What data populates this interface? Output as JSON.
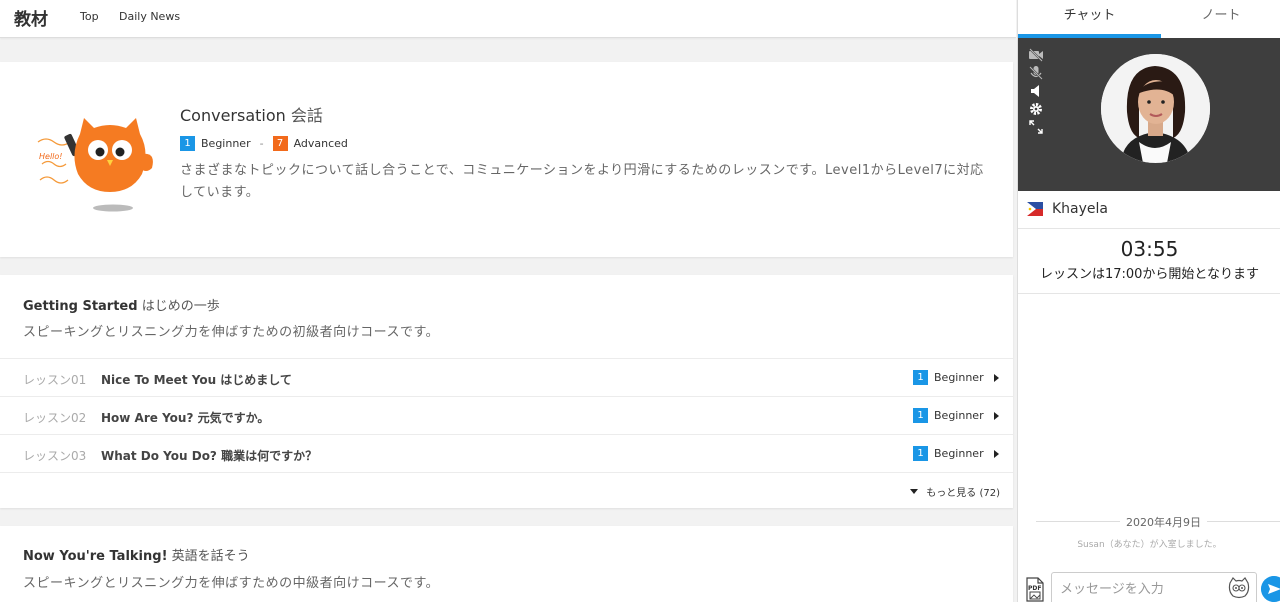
{
  "header": {
    "brand": "教材",
    "nav": [
      {
        "label": "Top"
      },
      {
        "label": "Daily News"
      }
    ]
  },
  "hero": {
    "title_en": "Conversation",
    "title_jp": "会話",
    "level_from": {
      "number": "1",
      "label": "Beginner"
    },
    "level_separator": "-",
    "level_to": {
      "number": "7",
      "label": "Advanced"
    },
    "description": "さまざまなトピックについて話し合うことで、コミュニケーションをより円滑にするためのレッスンです。Level1からLevel7に対応しています。",
    "mascot_label": "Hello!"
  },
  "sections": [
    {
      "title_en": "Getting Started",
      "title_jp": "はじめの一歩",
      "description": "スピーキングとリスニング力を伸ばすための初級者向けコースです。",
      "lessons": [
        {
          "number": "レッスン01",
          "title": "Nice To Meet You はじめまして",
          "level_number": "1",
          "level_label": "Beginner"
        },
        {
          "number": "レッスン02",
          "title": "How Are You? 元気ですか。",
          "level_number": "1",
          "level_label": "Beginner"
        },
        {
          "number": "レッスン03",
          "title": "What Do You Do? 職業は何ですか？",
          "level_number": "1",
          "level_label": "Beginner"
        }
      ],
      "more_label": "もっと見る (72)"
    },
    {
      "title_en": "Now You're Talking!",
      "title_jp": "英語を話そう",
      "description": "スピーキングとリスニング力を伸ばすための中級者向けコースです。"
    }
  ],
  "sidebar": {
    "tabs": [
      {
        "label": "チャット"
      },
      {
        "label": "ノート"
      }
    ],
    "video_controls": [
      "camera-off-icon",
      "mic-off-icon",
      "speaker-icon",
      "gear-icon",
      "expand-icon"
    ],
    "tutor_name": "Khayela",
    "timer": "03:55",
    "timer_note": "レッスンは17:00から開始となります",
    "chat_date": "2020年4月9日",
    "system_message": "Susan（あなた）が入室しました。",
    "input_placeholder": "メッセージを入力"
  },
  "colors": {
    "accent_blue": "#1a96e6",
    "accent_orange": "#f26a1b",
    "video_bg": "#3e3e3e"
  }
}
